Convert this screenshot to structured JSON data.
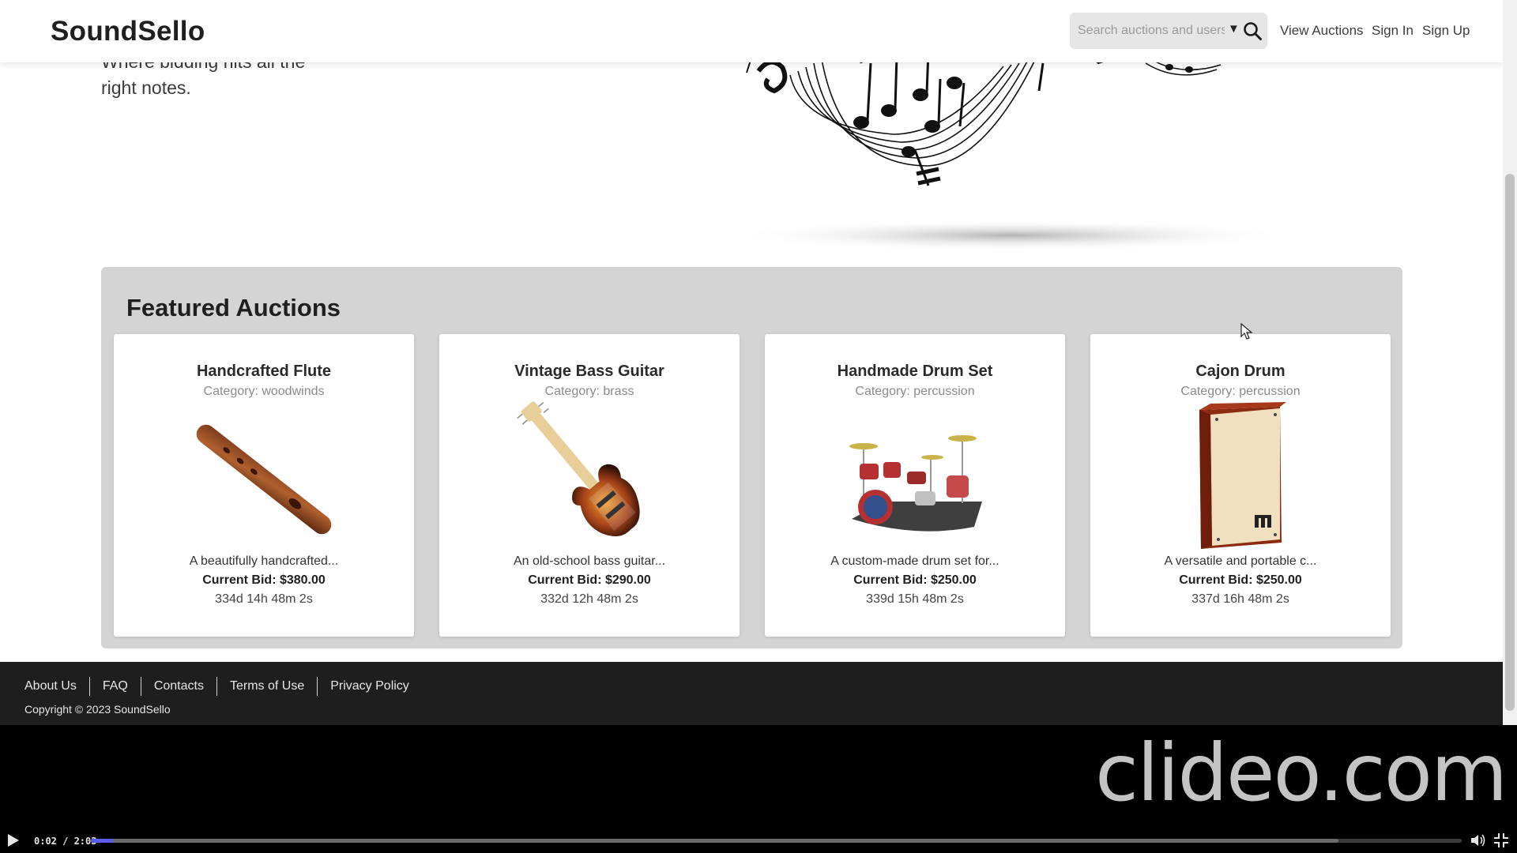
{
  "header": {
    "logo": "SoundSello",
    "search_placeholder": "Search auctions and users",
    "nav": [
      "View Auctions",
      "Sign In",
      "Sign Up"
    ]
  },
  "hero": {
    "tagline": "Where bidding hits all the right notes."
  },
  "featured": {
    "title": "Featured Auctions",
    "cards": [
      {
        "title": "Handcrafted Flute",
        "category": "Category: woodwinds",
        "description": "A beautifully handcrafted...",
        "bid": "Current Bid: $380.00",
        "time_left": "334d 14h 48m 2s",
        "image_icon": "flute-icon"
      },
      {
        "title": "Vintage Bass Guitar",
        "category": "Category: brass",
        "description": "An old-school bass guitar...",
        "bid": "Current Bid: $290.00",
        "time_left": "332d 12h 48m 2s",
        "image_icon": "bass-guitar-icon"
      },
      {
        "title": "Handmade Drum Set",
        "category": "Category: percussion",
        "description": "A custom-made drum set for...",
        "bid": "Current Bid: $250.00",
        "time_left": "339d 15h 48m 2s",
        "image_icon": "drum-set-icon"
      },
      {
        "title": "Cajon Drum",
        "category": "Category: percussion",
        "description": "A versatile and portable c...",
        "bid": "Current Bid: $250.00",
        "time_left": "337d 16h 48m 2s",
        "image_icon": "cajon-drum-icon"
      }
    ]
  },
  "footer": {
    "links": [
      "About Us",
      "FAQ",
      "Contacts",
      "Terms of Use",
      "Privacy Policy"
    ],
    "copyright": "Copyright © 2023 SoundSello"
  },
  "video_player": {
    "watermark": "clideo.com",
    "time": "0:02 / 2:03",
    "progress_fraction": 0.016,
    "buffered_fraction": 0.91,
    "progress_color": "#5a5ef0"
  },
  "colors": {
    "footer_bg": "#1e1e1e",
    "section_bg": "#d4d4d4"
  }
}
